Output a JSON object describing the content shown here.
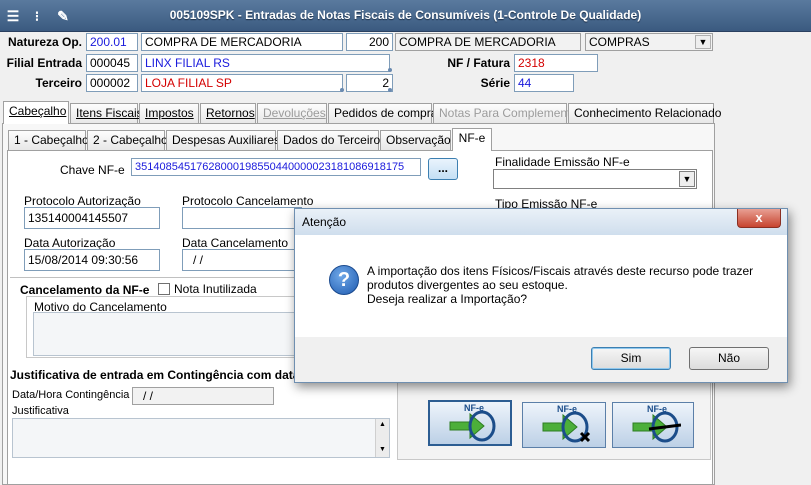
{
  "window": {
    "title": "005109SPK - Entradas de Notas Fiscais de Consumíveis (1-Controle De Qualidade)"
  },
  "header": {
    "natureza_label": "Natureza Op.",
    "natureza_code": "200.01",
    "natureza_desc": "COMPRA DE MERCADORIA",
    "natureza_num": "200",
    "natureza_desc2": "COMPRA DE MERCADORIA",
    "natureza_type": "COMPRAS",
    "filial_label": "Filial Entrada",
    "filial_code": "000045",
    "filial_name": "LINX FILIAL RS",
    "terceiro_label": "Terceiro",
    "terceiro_code": "000002",
    "terceiro_name": "LOJA FILIAL SP",
    "terceiro_num": "2",
    "nf_label": "NF / Fatura",
    "nf_value": "2318",
    "serie_label": "Série",
    "serie_value": "44"
  },
  "main_tabs": [
    {
      "label": "Cabeçalho"
    },
    {
      "label": "Itens Fiscais"
    },
    {
      "label": "Impostos"
    },
    {
      "label": "Retornos"
    },
    {
      "label": "Devoluções"
    },
    {
      "label": "Pedidos de compra"
    },
    {
      "label": "Notas Para Complemento"
    },
    {
      "label": "Conhecimento Relacionado"
    }
  ],
  "sub_tabs": [
    {
      "label": "1 - Cabeçalho"
    },
    {
      "label": "2 - Cabeçalho"
    },
    {
      "label": "Despesas Auxiliares"
    },
    {
      "label": "Dados do Terceiro"
    },
    {
      "label": "Observação"
    },
    {
      "label": "NF-e"
    }
  ],
  "nfe": {
    "chave_label": "Chave NF-e",
    "chave_value": "35140854517628000198550440000023181086918175",
    "chave_button": "...",
    "finalidade_label": "Finalidade Emissão NF-e",
    "tipo_label": "Tipo Emissão NF-e",
    "protocolo_aut_label": "Protocolo Autorização",
    "protocolo_aut_value": "135140004145507",
    "protocolo_canc_label": "Protocolo Cancelamento",
    "data_aut_label": "Data Autorização",
    "data_aut_value": "15/08/2014 09:30:56",
    "data_canc_label": "Data Cancelamento",
    "data_canc_value": "/ /",
    "cancelamento_label": "Cancelamento da NF-e",
    "nota_inutilizada_label": "Nota Inutilizada",
    "motivo_label": "Motivo do Cancelamento",
    "justificativa_section": "Justificativa de entrada em Contingência com data",
    "data_hora_label": "Data/Hora Contingência",
    "data_hora_value": "/ /",
    "justificativa_label": "Justificativa"
  },
  "dialog": {
    "title": "Atenção",
    "line1": "A importação dos itens Físicos/Fiscais através deste recurso pode trazer",
    "line2": "produtos divergentes ao seu estoque.",
    "line3": "Deseja realizar a Importação?",
    "yes": "Sim",
    "no": "Não",
    "close": "x"
  },
  "icons": {
    "nfe_logo_text": "NF-e"
  },
  "colors": {
    "title_bar": "#3b5a80",
    "blue_value": "#1a1adc",
    "red_value": "#d40000"
  }
}
